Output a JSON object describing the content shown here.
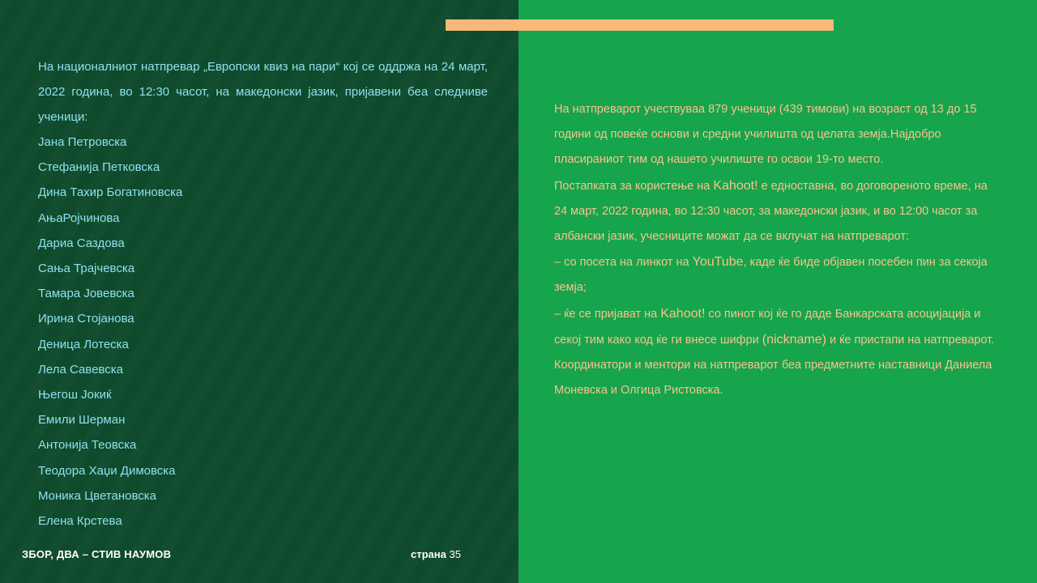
{
  "left": {
    "intro": "На националниот  натпревар  „Европски квиз на пари“  кој се оддржа на  24 март, 2022 година, во 12:30 часот, на македонски јазик, пријавени беа следниве ученици:",
    "students": [
      "Јана Петровска",
      "Стефанија Петковска",
      "Дина Тахир Богатиновска",
      "АњаРојчинова",
      "Дариа Саздова",
      "Сања Трајчевска",
      "Тамара Јовевска",
      "Ирина Стојанова",
      "Деница Лотеска",
      "Лела Савевска",
      "Његош Јокиќ",
      "Емили Шерман",
      "Антонија Теовска",
      "Теодора Хаџи Димовска",
      "Моника Цветановска",
      "Елена Крстева"
    ]
  },
  "footer": {
    "title": "ЗБОР, ДВА – СТИВ НАУМОВ",
    "page_label": "страна",
    "page_number": "35"
  },
  "right": {
    "p1": "На натпреварот учествуваа 879 ученици (439 тимови) на возраст од 13 до 15 години од повеќе основи и средни училишта од целата земја.Најдобро пласираниот тим од нашето училиште го освои 19-то место.",
    "p2_a": "Постапката за користење на ",
    "p2_kahoot": "Kahoot!",
    "p2_b": " е едноставна, во договореното време, на 24 март, 2022 година, во 12:30 часот, за македонски јазик, и во 12:00 часот за албански јазик, учесниците  можат да се вклучат на натпреварот:",
    "p3_a": "– со посета на линкот на ",
    "p3_youtube": "YouTube",
    "p3_b": ", каде ќе биде објавен посебен пин за секоја земја;",
    "p4_a": "– ќе се пријават на ",
    "p4_kahoot": "Kahoot!",
    "p4_b": " со пинот кој ќе  го даде Банкарската асоцијација  и секој тим како код ќе ги внесе шифри ",
    "p4_nick": "(nickname)",
    "p4_c": " и ќе пристапи на натпреварот.",
    "p5": "Координатори и ментори на натпреварот беа предметните наставници Даниела Моневска и Олгица Ристовска."
  },
  "colors": {
    "left_bg": "#0e4a2b",
    "right_bg": "#16a44c",
    "accent": "#f6b978",
    "left_text": "#8fe0ee",
    "right_text": "#f7c48d"
  }
}
